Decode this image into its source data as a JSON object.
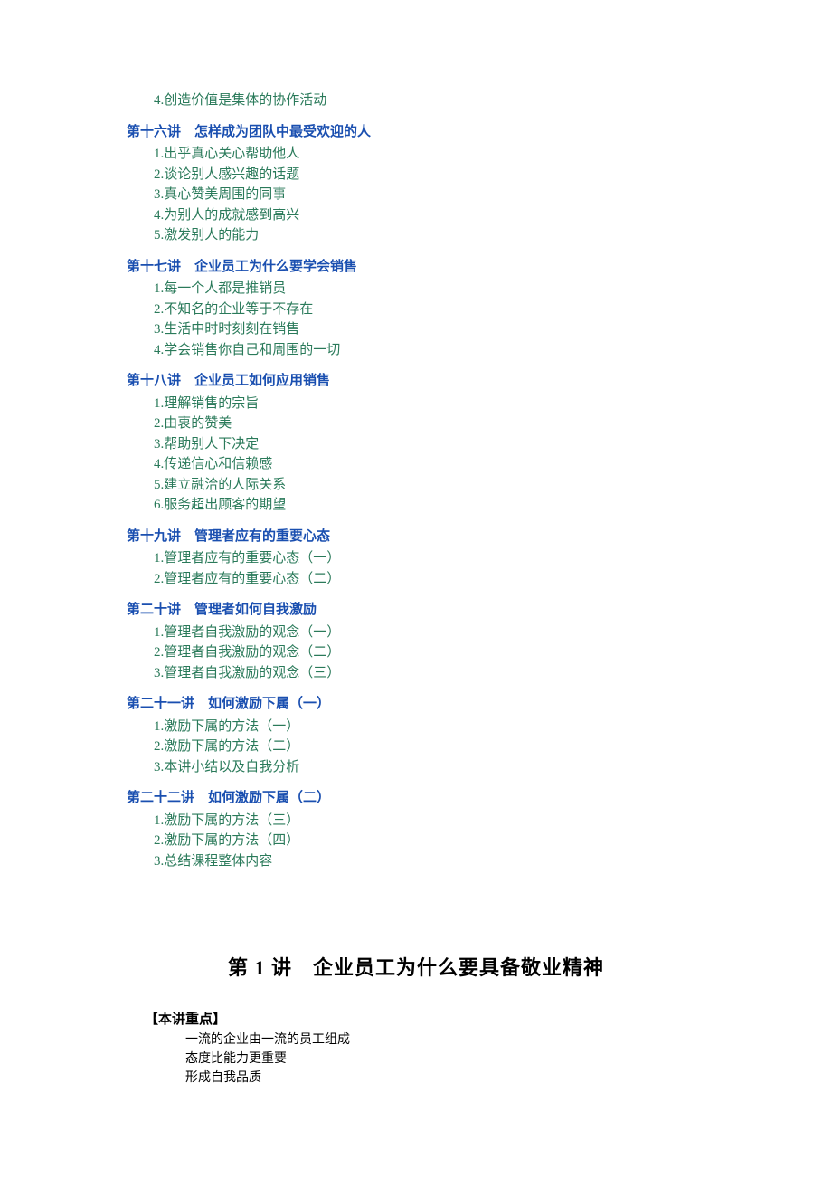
{
  "orphan": "4.创造价值是集体的协作活动",
  "sections": [
    {
      "title": "第十六讲　怎样成为团队中最受欢迎的人",
      "items": [
        "1.出乎真心关心帮助他人",
        "2.谈论别人感兴趣的话题",
        "3.真心赞美周围的同事",
        "4.为别人的成就感到高兴",
        "5.激发别人的能力"
      ]
    },
    {
      "title": "第十七讲　企业员工为什么要学会销售",
      "items": [
        "1.每一个人都是推销员",
        "2.不知名的企业等于不存在",
        "3.生活中时时刻刻在销售",
        "4.学会销售你自己和周围的一切"
      ]
    },
    {
      "title": "第十八讲　企业员工如何应用销售",
      "items": [
        "1.理解销售的宗旨",
        "2.由衷的赞美",
        "3.帮助别人下决定",
        "4.传递信心和信赖感",
        "5.建立融洽的人际关系",
        "6.服务超出顾客的期望"
      ]
    },
    {
      "title": "第十九讲　管理者应有的重要心态",
      "items": [
        "1.管理者应有的重要心态（一）",
        "2.管理者应有的重要心态（二）"
      ]
    },
    {
      "title": "第二十讲　管理者如何自我激励",
      "items": [
        "1.管理者自我激励的观念（一）",
        "2.管理者自我激励的观念（二）",
        "3.管理者自我激励的观念（三）"
      ]
    },
    {
      "title": "第二十一讲　如何激励下属（一）",
      "items": [
        "1.激励下属的方法（一）",
        "2.激励下属的方法（二）",
        "3.本讲小结以及自我分析"
      ]
    },
    {
      "title": "第二十二讲　如何激励下属（二）",
      "items": [
        "1.激励下属的方法（三）",
        "2.激励下属的方法（四）",
        "3.总结课程整体内容"
      ]
    }
  ],
  "lecture": {
    "heading": "第 1 讲　企业员工为什么要具备敬业精神",
    "keypoints_label": "【本讲重点】",
    "keypoints": [
      "一流的企业由一流的员工组成",
      "态度比能力更重要",
      "形成自我品质"
    ]
  }
}
